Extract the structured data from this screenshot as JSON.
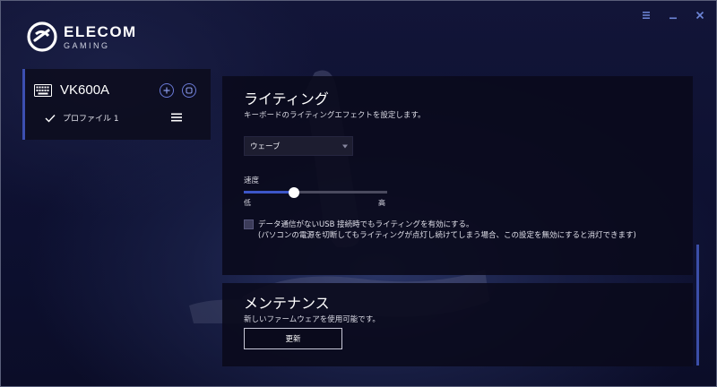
{
  "window": {
    "controls": [
      "menu",
      "minimize",
      "close"
    ]
  },
  "logo": {
    "brand": "ELECOM",
    "sub": "GAMING"
  },
  "device": {
    "name": "VK600A",
    "profile": "プロファイル 1"
  },
  "lighting": {
    "title": "ライティング",
    "description": "キーボードのライティングエフェクトを設定します。",
    "effect_value": "ウェーブ",
    "speed_label": "速度",
    "speed_min_label": "低",
    "speed_max_label": "高",
    "speed_fraction": 0.35,
    "checkbox_checked": false,
    "checkbox_text": "データ通信がないUSB 接続時でもライティングを有効にする。",
    "checkbox_note": "(パソコンの電源を切断してもライティングが点灯し続けてしまう場合、この設定を無効にすると消灯できます)"
  },
  "maintenance": {
    "title": "メンテナンス",
    "description": "新しいファームウェアを使用可能です。",
    "update_button": "更新"
  },
  "colors": {
    "accent": "#3d56c8",
    "panel_bg": "#0a0a1c",
    "background": "#0f1230"
  }
}
